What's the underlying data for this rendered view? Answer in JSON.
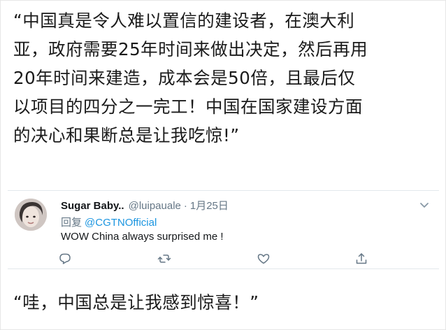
{
  "quote_top": {
    "lines": [
      "“中国真是令人难以置信的建设者，在澳大利",
      "亚，政府需要25年时间来做出决定，然后再用",
      "20年时间来建造，成本会是50倍，且最后仅",
      "以项目的四分之一完工！中国在国家建设方面",
      "的决心和果断总是让我吃惊!”"
    ]
  },
  "tweet": {
    "display_name": "Sugar Baby..",
    "handle": "@luipauale",
    "separator": "·",
    "date": "1月25日",
    "reply_prefix": "回复",
    "reply_mention": "@CGTNOfficial",
    "text": "WOW China always surprised me !",
    "colors": {
      "mention": "#1b95e0",
      "meta": "#657786",
      "text": "#14171a"
    },
    "icons": [
      "comment-icon",
      "retweet-icon",
      "like-icon",
      "share-icon",
      "chevron-down-icon"
    ]
  },
  "quote_bottom": {
    "text": "“哇，中国总是让我感到惊喜！”"
  }
}
